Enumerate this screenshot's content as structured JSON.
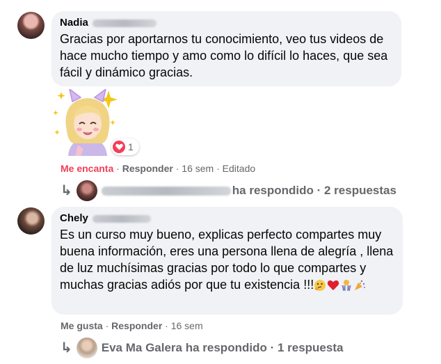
{
  "comments": [
    {
      "author_first": "Nadia",
      "text": "Gracias por aportarnos tu conocimiento, veo tus videos de hace mucho tiempo y amo como lo difícil lo haces, que sea fácil y dinámico gracias.",
      "reaction_count": "1",
      "reaction_label": "Me encanta",
      "reply_label": "Responder",
      "time": "16 sem",
      "edited": "Editado",
      "replies_summary": "ha respondido · 2 respuestas"
    },
    {
      "author_first": "Chely",
      "text": "Es un curso muy bueno, explicas perfecto compartes muy buena información, eres una persona llena de alegría , llena de luz muchísimas gracias por todo lo que compartes y muchas gracias adiós por que tu existencia !!!",
      "like_label": "Me gusta",
      "reply_label": "Responder",
      "time": "16 sem",
      "replies_summary": "Eva Ma Galera ha respondido · 1 respuesta"
    }
  ],
  "separator": "·",
  "icons": {
    "reply_arrow": "reply-arrow-icon",
    "heart": "heart-icon",
    "emojis": [
      "thinking-face-icon",
      "red-heart-icon",
      "confetti-ball-icon",
      "party-popper-icon"
    ]
  },
  "colors": {
    "bubble": "#f0f2f5",
    "secondary_text": "#65676b",
    "love": "#f33e58"
  }
}
